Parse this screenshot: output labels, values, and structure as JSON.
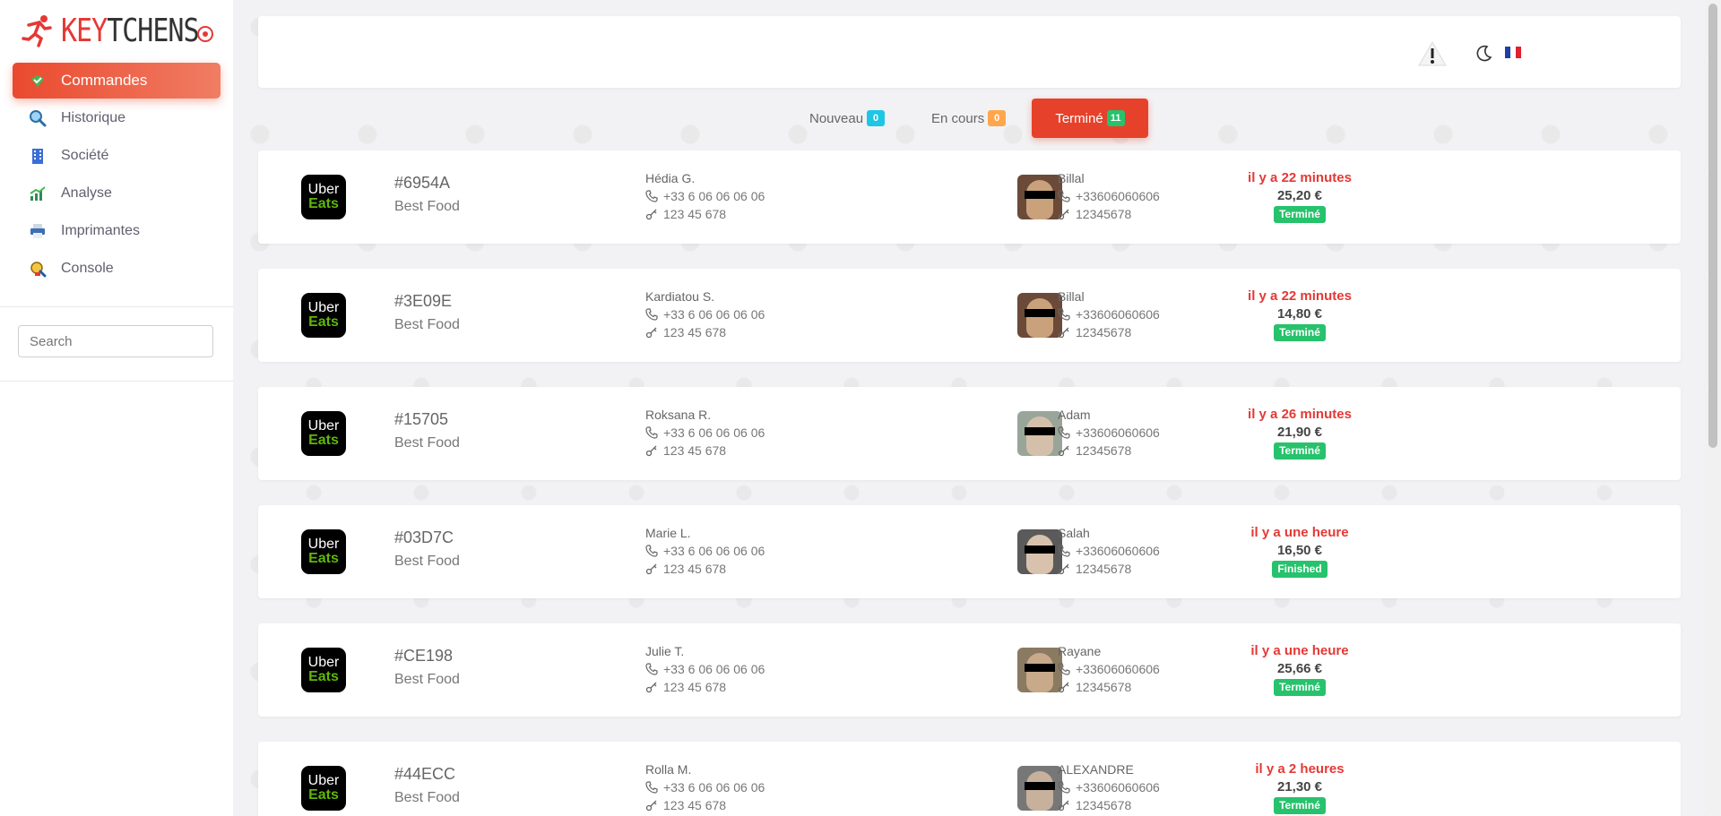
{
  "brand": {
    "key": "KEY",
    "rest": "TCHENS"
  },
  "sidebar": {
    "items": [
      {
        "label": "Commandes",
        "icon": "orders-check-icon",
        "active": true
      },
      {
        "label": "Historique",
        "icon": "search-magnifier-icon"
      },
      {
        "label": "Société",
        "icon": "building-icon"
      },
      {
        "label": "Analyse",
        "icon": "chart-icon"
      },
      {
        "label": "Imprimantes",
        "icon": "printer-icon"
      },
      {
        "label": "Console",
        "icon": "console-icon"
      }
    ],
    "search": {
      "placeholder": "Search"
    }
  },
  "tabs": {
    "new": {
      "label": "Nouveau",
      "count": "0"
    },
    "progress": {
      "label": "En cours",
      "count": "0"
    },
    "done": {
      "label": "Terminé",
      "count": "11"
    }
  },
  "colors": {
    "accent": "#e6412a",
    "success": "#27c26c",
    "info": "#1ec6e6",
    "warning": "#ffa64d"
  },
  "orders": [
    {
      "platform_line1": "Uber",
      "platform_line2": "Eats",
      "id": "#6954A",
      "shop": "Best Food",
      "customer": {
        "name": "Hédia G.",
        "phone": "+33 6 06 06 06 06",
        "code": "123 45 678"
      },
      "courier": {
        "name": "Billal",
        "phone": "+33606060606",
        "code": "12345678"
      },
      "time": "il y a 22 minutes",
      "amount": "25,20 €",
      "status": "Terminé"
    },
    {
      "platform_line1": "Uber",
      "platform_line2": "Eats",
      "id": "#3E09E",
      "shop": "Best Food",
      "customer": {
        "name": "Kardiatou S.",
        "phone": "+33 6 06 06 06 06",
        "code": "123 45 678"
      },
      "courier": {
        "name": "Billal",
        "phone": "+33606060606",
        "code": "12345678"
      },
      "time": "il y a 22 minutes",
      "amount": "14,80 €",
      "status": "Terminé"
    },
    {
      "platform_line1": "Uber",
      "platform_line2": "Eats",
      "id": "#15705",
      "shop": "Best Food",
      "customer": {
        "name": "Roksana R.",
        "phone": "+33 6 06 06 06 06",
        "code": "123 45 678"
      },
      "courier": {
        "name": "Adam",
        "phone": "+33606060606",
        "code": "12345678"
      },
      "time": "il y a 26 minutes",
      "amount": "21,90 €",
      "status": "Terminé"
    },
    {
      "platform_line1": "Uber",
      "platform_line2": "Eats",
      "id": "#03D7C",
      "shop": "Best Food",
      "customer": {
        "name": "Marie L.",
        "phone": "+33 6 06 06 06 06",
        "code": "123 45 678"
      },
      "courier": {
        "name": "Salah",
        "phone": "+33606060606",
        "code": "12345678"
      },
      "time": "il y a une heure",
      "amount": "16,50 €",
      "status": "Finished"
    },
    {
      "platform_line1": "Uber",
      "platform_line2": "Eats",
      "id": "#CE198",
      "shop": "Best Food",
      "customer": {
        "name": "Julie T.",
        "phone": "+33 6 06 06 06 06",
        "code": "123 45 678"
      },
      "courier": {
        "name": "Rayane",
        "phone": "+33606060606",
        "code": "12345678"
      },
      "time": "il y a une heure",
      "amount": "25,66 €",
      "status": "Terminé"
    },
    {
      "platform_line1": "Uber",
      "platform_line2": "Eats",
      "id": "#44ECC",
      "shop": "Best Food",
      "customer": {
        "name": "Rolla M.",
        "phone": "+33 6 06 06 06 06",
        "code": "123 45 678"
      },
      "courier": {
        "name": "ALEXANDRE",
        "phone": "+33606060606",
        "code": "12345678"
      },
      "time": "il y a 2 heures",
      "amount": "21,30 €",
      "status": "Terminé"
    }
  ]
}
